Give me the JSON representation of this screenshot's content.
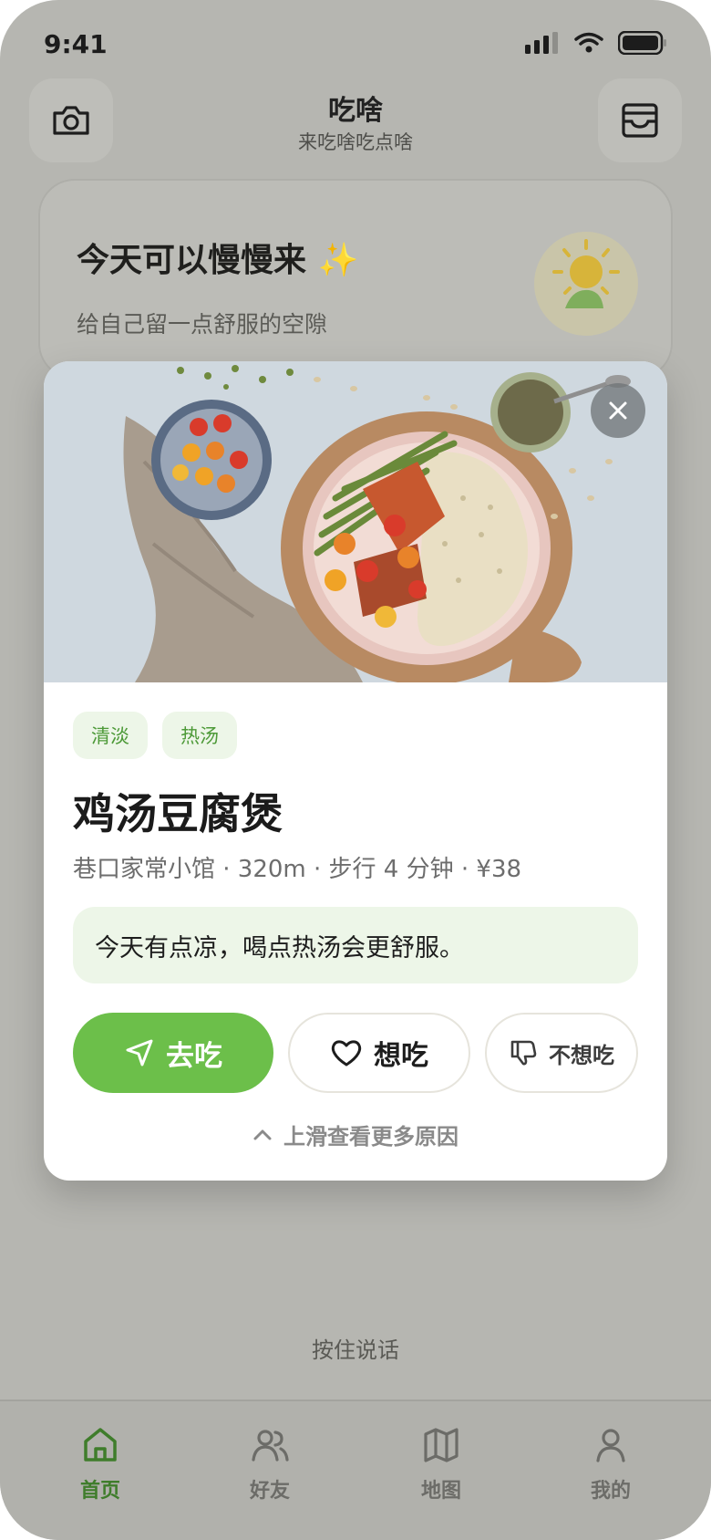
{
  "status_bar": {
    "time": "9:41"
  },
  "header": {
    "title": "吃啥",
    "subtitle": "来吃啥吃点啥",
    "left_icon": "camera-icon",
    "right_icon": "inbox-icon"
  },
  "mood_card": {
    "title": "今天可以慢慢来 ✨",
    "subtitle": "给自己留一点舒服的空隙",
    "icon": "sun-icon"
  },
  "recommendation": {
    "tags": [
      "清淡",
      "热汤"
    ],
    "dish_name": "鸡汤豆腐煲",
    "meta": "巷口家常小馆 · 320m · 步行 4 分钟 · ¥38",
    "reason": "今天有点凉，喝点热汤会更舒服。",
    "actions": {
      "go_label": "去吃",
      "want_label": "想吃",
      "dislike_label": "不想吃"
    },
    "more_label": "上滑查看更多原因"
  },
  "voice": {
    "hold_to_talk": "按住说话"
  },
  "tabbar": {
    "items": [
      {
        "label": "首页",
        "icon": "home-icon",
        "active": true
      },
      {
        "label": "好友",
        "icon": "friends-icon",
        "active": false
      },
      {
        "label": "地图",
        "icon": "map-icon",
        "active": false
      },
      {
        "label": "我的",
        "icon": "profile-icon",
        "active": false
      }
    ]
  },
  "colors": {
    "accent": "#6cbf4a",
    "tag_bg": "#edf6e8",
    "tag_text": "#4d9a38",
    "active_tab": "#3f7d2b"
  }
}
